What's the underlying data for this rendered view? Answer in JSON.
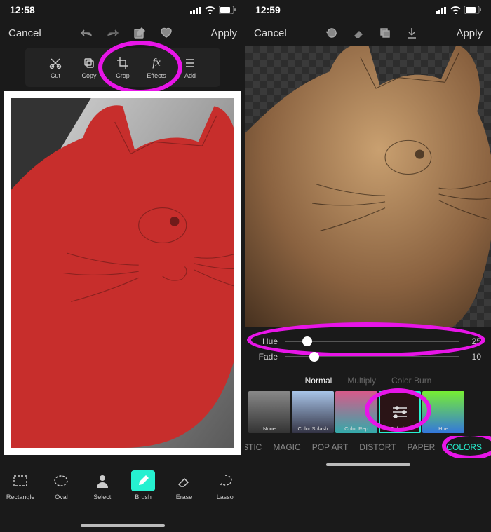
{
  "left": {
    "time": "12:58",
    "cancel": "Cancel",
    "apply": "Apply",
    "tools": {
      "cut": "Cut",
      "copy": "Copy",
      "crop": "Crop",
      "effects": "Effects",
      "add": "Add"
    },
    "bottom": {
      "rectangle": "Rectangle",
      "oval": "Oval",
      "select": "Select",
      "brush": "Brush",
      "erase": "Erase",
      "lasso": "Lasso"
    },
    "image_subject": "cat",
    "mask_color": "#c72e2c"
  },
  "right": {
    "time": "12:59",
    "cancel": "Cancel",
    "apply": "Apply",
    "sliders": {
      "hue": {
        "label": "Hue",
        "value": 25,
        "min": 0,
        "max": 100,
        "thumb_pct": 10
      },
      "fade": {
        "label": "Fade",
        "value": 10,
        "min": 0,
        "max": 100,
        "thumb_pct": 14
      }
    },
    "blend_modes": {
      "normal": "Normal",
      "multiply": "Multiply",
      "color_burn": "Color Burn",
      "selected": "normal"
    },
    "filters": [
      {
        "id": "none",
        "label": "None"
      },
      {
        "id": "color_splash",
        "label": "Color Splash"
      },
      {
        "id": "color_rep",
        "label": "Color Rep"
      },
      {
        "id": "colorize",
        "label": "Colorize",
        "selected": true
      },
      {
        "id": "hue",
        "label": "Hue"
      }
    ],
    "categories": {
      "artistic": "STIC",
      "magic": "MAGIC",
      "pop_art": "POP ART",
      "distort": "DISTORT",
      "paper": "PAPER",
      "colors": "COLORS",
      "active": "colors"
    },
    "image_subject": "cat",
    "tint": "#a0764e"
  },
  "annotation_color": "#e815e8",
  "accent_color": "#26f0d0"
}
